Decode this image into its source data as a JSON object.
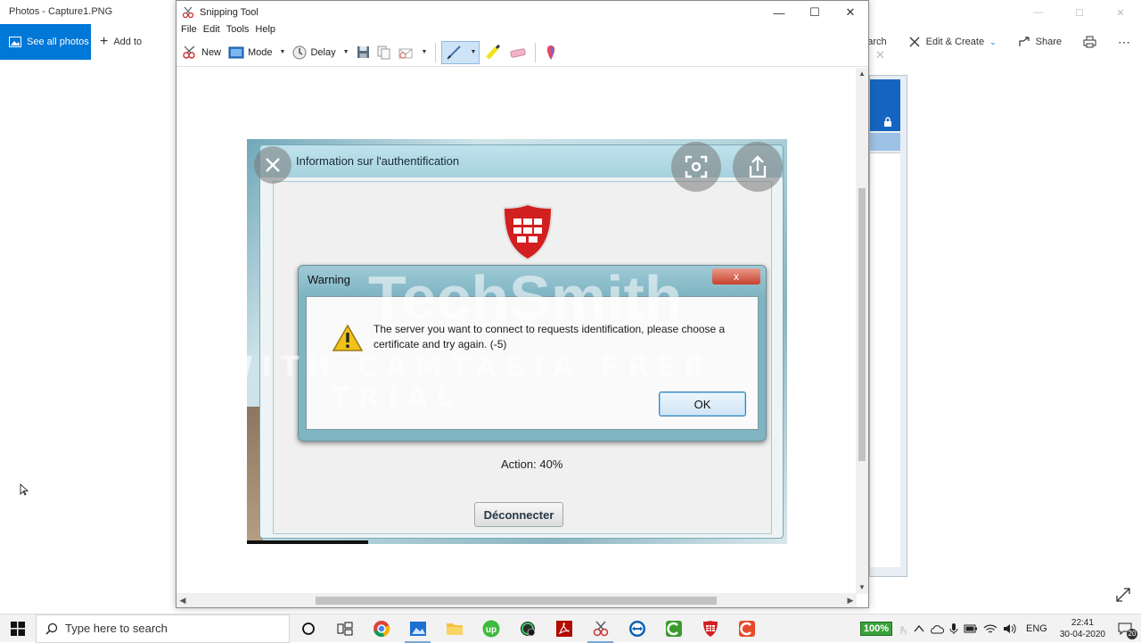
{
  "photos": {
    "title": "Photos - Capture1.PNG",
    "see_all": "See all photos",
    "add_to": "Add to",
    "toolbar": {
      "search": "Search",
      "edit_create": "Edit & Create",
      "share": "Share"
    }
  },
  "snipping": {
    "title": "Snipping Tool",
    "menu": [
      "File",
      "Edit",
      "Tools",
      "Help"
    ],
    "toolbar": {
      "new": "New",
      "mode": "Mode",
      "delay": "Delay"
    }
  },
  "capture": {
    "auth_title": "Information sur l'authentification",
    "warning_title": "Warning",
    "warning_close": "x",
    "warning_message": "The server you want to connect to requests identification, please choose a certificate and try again. (-5)",
    "ok_label": "OK",
    "action_text": "Action: 40%",
    "disconnect_label": "Déconnecter",
    "watermark_brand": "TechSmith",
    "watermark_line": "MADE WITH CAMTASIA FREE TRIAL"
  },
  "taskbar": {
    "search_placeholder": "Type here to search",
    "zoom": "100%",
    "language": "ENG",
    "time": "22:41",
    "date": "30-04-2020",
    "notification_count": "20"
  },
  "colors": {
    "accent": "#0078d7",
    "warning_close": "#c8412c",
    "fortinet_red": "#d21f1f"
  }
}
